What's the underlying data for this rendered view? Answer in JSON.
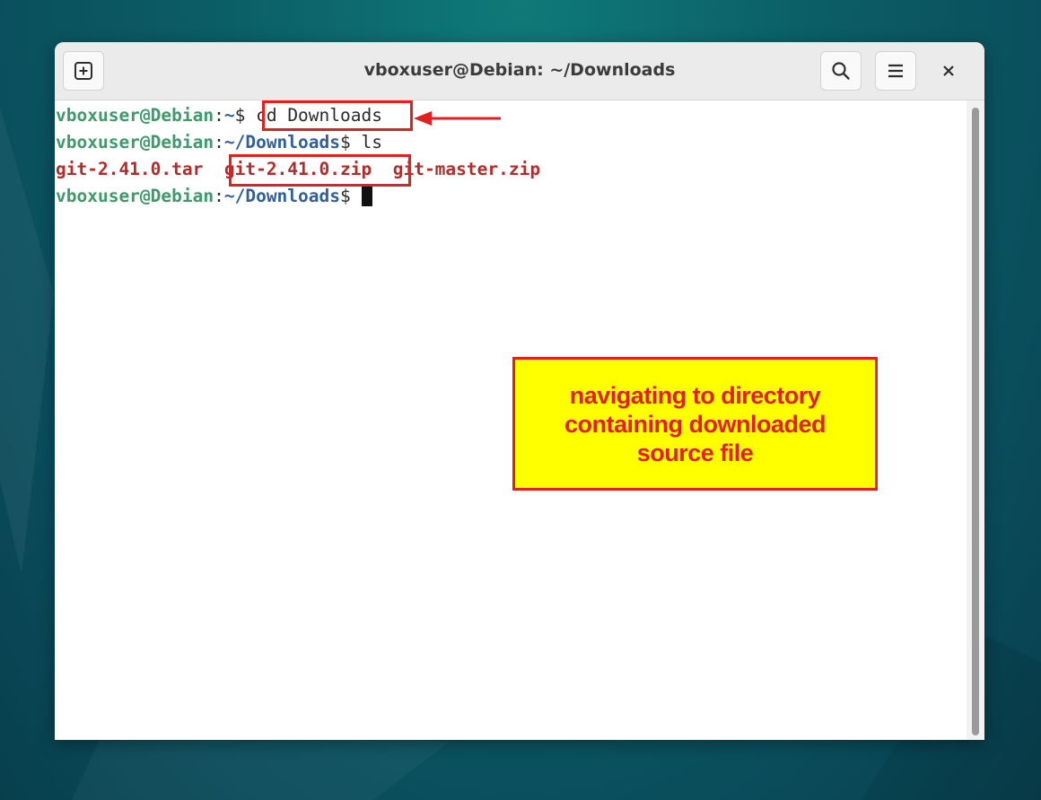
{
  "window": {
    "title": "vboxuser@Debian: ~/Downloads"
  },
  "icons": {
    "new_tab": "plus-box-icon",
    "search": "search-icon",
    "menu": "hamburger-menu-icon",
    "close": "close-icon"
  },
  "terminal": {
    "lines": [
      {
        "user": "vboxuser@Debian",
        "sep": ":",
        "path": "~",
        "dollar": "$",
        "command": " cd Downloads"
      },
      {
        "user": "vboxuser@Debian",
        "sep": ":",
        "path": "~/Downloads",
        "dollar": "$",
        "command": " ls"
      },
      {
        "files": [
          "git-2.41.0.tar",
          "git-2.41.0.zip",
          "git-master.zip"
        ]
      },
      {
        "user": "vboxuser@Debian",
        "sep": ":",
        "path": "~/Downloads",
        "dollar": "$",
        "command": " "
      }
    ]
  },
  "annotation": {
    "callout_text": "navigating to directory containing downloaded source file"
  },
  "colors": {
    "prompt_user": "#3e9a6b",
    "prompt_path": "#2f5f9e",
    "file": "#b52a2a",
    "highlight": "#e3201f",
    "callout_bg": "#ffff00"
  }
}
